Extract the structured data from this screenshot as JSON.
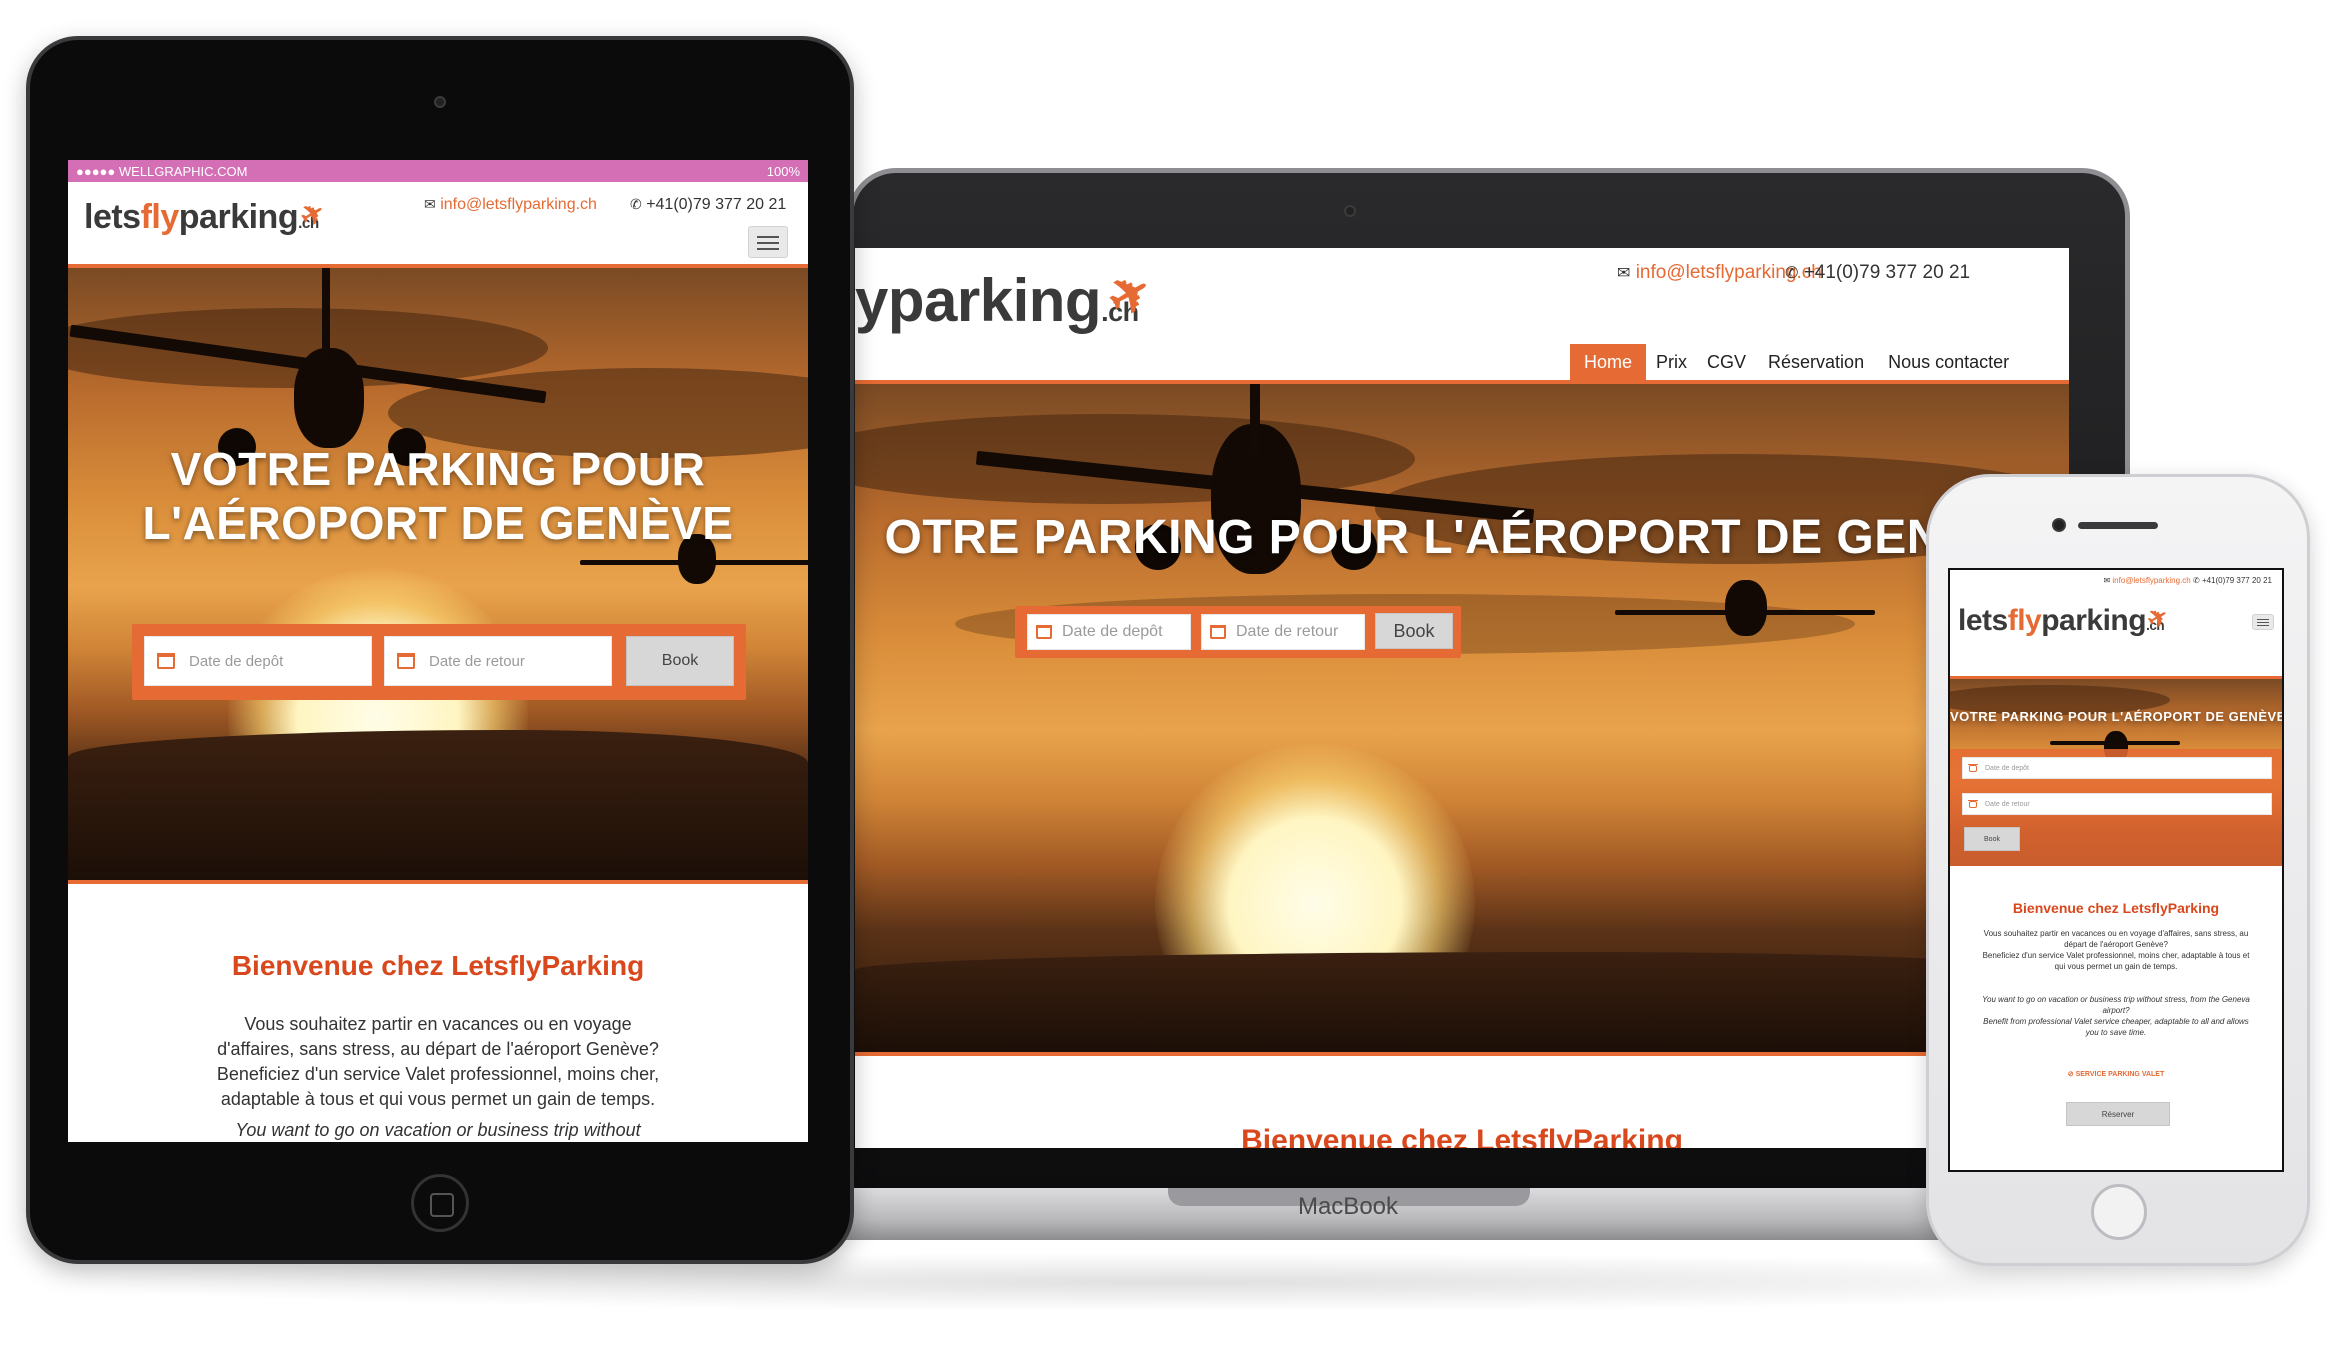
{
  "site": {
    "logo_prefix": "lets",
    "logo_fly": "fly",
    "logo_parking": "parking",
    "logo_suffix": ".ch",
    "logo_partial": "yparking",
    "email": "info@letsflyparking.ch",
    "phone": "+41(0)79 377 20 21",
    "nav": [
      "Home",
      "Prix",
      "CGV",
      "Réservation",
      "Nous contacter"
    ],
    "hero_title_line1": "VOTRE PARKING POUR",
    "hero_title_line2": "L'AÉROPORT DE GENÈVE",
    "hero_title_laptop": "OTRE PARKING POUR L'AÉROPORT DE GENÈVE",
    "hero_title_phone": "VOTRE PARKING POUR L'AÉROPORT DE GENÈVE",
    "date_depot_placeholder": "Date de depôt",
    "date_retour_placeholder": "Date de retour",
    "book_label": "Book",
    "welcome_title": "Bienvenue chez LetsflyParking",
    "welcome_title_cut": "Bienvenue chez LetsflyParking",
    "intro_fr_tablet": [
      "Vous souhaitez partir en vacances ou en voyage",
      "d'affaires, sans stress, au départ de l'aéroport Genève?",
      "Beneficiez d'un service Valet professionnel, moins cher,",
      "adaptable à tous et qui vous permet un gain de temps."
    ],
    "intro_en_tablet": "You want to go on vacation or business trip without",
    "intro_fr_phone": [
      "Vous souhaitez partir en vacances ou en voyage d'affaires, sans stress, au",
      "départ de l'aéroport Genève?",
      "Beneficiez d'un service Valet professionnel, moins cher, adaptable à tous et",
      "qui vous permet un gain de temps."
    ],
    "intro_en_phone": [
      "You want to go on vacation or business trip without stress, from the Geneva",
      "airport?",
      "Benefit from professional Valet service cheaper, adaptable to all and allows",
      "you to save time."
    ],
    "service_link": "SERVICE PARKING VALET",
    "reserve_label": "Réserver"
  },
  "tablet_status": {
    "carrier": "●●●●● WELLGRAPHIC.COM",
    "battery": "100%"
  },
  "laptop_brand": "MacBook",
  "colors": {
    "accent": "#e56a33",
    "title": "#d9481c",
    "status_bar": "#d46fb6"
  },
  "icons": [
    "mail-icon",
    "phone-icon",
    "calendar-icon",
    "hamburger-menu-icon",
    "plane-logo-icon",
    "check-circle-icon"
  ]
}
